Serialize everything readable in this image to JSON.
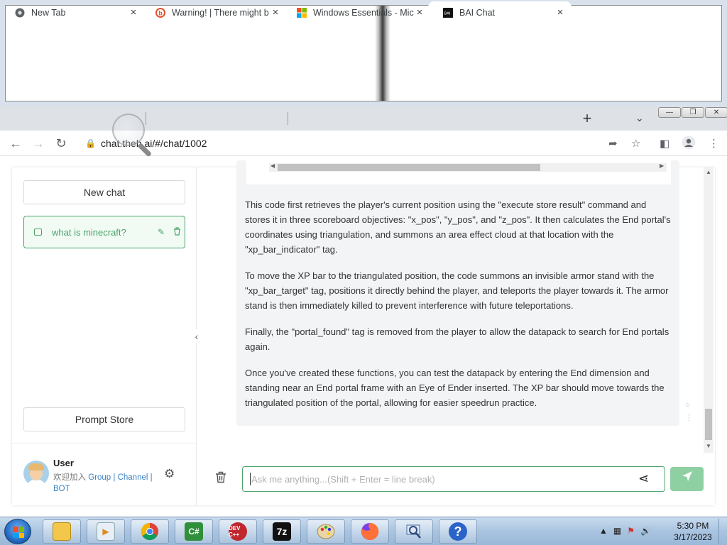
{
  "tabs": [
    {
      "label": "New Tab",
      "icon": "chrome-icon"
    },
    {
      "label": "Warning! | There might b",
      "icon": "warning-site-icon"
    },
    {
      "label": "Windows Essentials - Mic",
      "icon": "microsoft-icon"
    },
    {
      "label": "BAI Chat",
      "icon": "bai-icon",
      "active": true
    }
  ],
  "address": {
    "url": "chat.theb.ai/#/chat/1002"
  },
  "sidebar": {
    "new_chat": "New chat",
    "chat_items": [
      {
        "label": "what is minecraft?"
      }
    ],
    "prompt_store": "Prompt Store",
    "user": {
      "name": "User",
      "welcome": "欢迎加入",
      "link_group": "Group",
      "link_channel": "Channel",
      "link_bot": "BOT",
      "sep": "|"
    }
  },
  "message": {
    "paragraphs": [
      "This code first retrieves the player's current position using the \"execute store result\" command and stores it in three scoreboard objectives: \"x_pos\", \"y_pos\", and \"z_pos\". It then calculates the End portal's coordinates using triangulation, and summons an area effect cloud at that location with the \"xp_bar_indicator\" tag.",
      "To move the XP bar to the triangulated position, the code summons an invisible armor stand with the \"xp_bar_target\" tag, positions it directly behind the player, and teleports the player towards it. The armor stand is then immediately killed to prevent interference with future teleportations.",
      "Finally, the \"portal_found\" tag is removed from the player to allow the datapack to search for End portals again.",
      "Once you've created these functions, you can test the datapack by entering the End dimension and standing near an End portal frame with an Eye of Ender inserted. The XP bar should move towards the triangulated position of the portal, allowing for easier speedrun practice."
    ]
  },
  "input": {
    "placeholder": "Ask me anything...(Shift + Enter = line break)"
  },
  "taskbar": {
    "apps": [
      "file-explorer",
      "media-player",
      "chrome",
      "csharp-ide",
      "dev-cpp",
      "7zip",
      "paint",
      "firefox",
      "network-app",
      "help"
    ],
    "labels": {
      "csharp": "C#",
      "devcpp": "DEV C++",
      "sevenzip": "7z",
      "help": "?"
    },
    "time": "5:30 PM",
    "date": "3/17/2023"
  },
  "colors": {
    "accent": "#4aa36a",
    "send_button": "#8fd0a2",
    "link": "#3b82c4"
  }
}
